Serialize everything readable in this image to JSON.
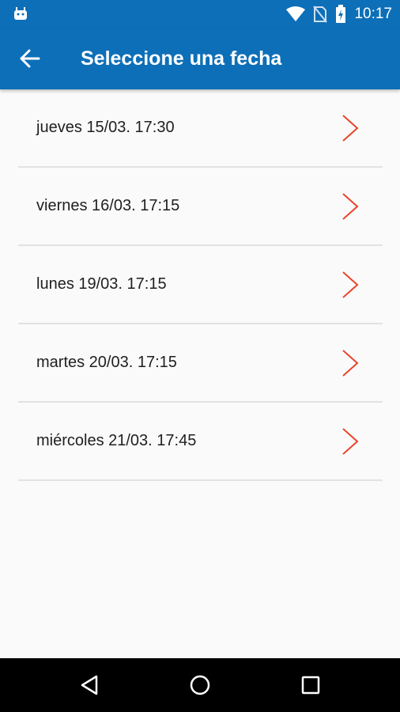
{
  "status_bar": {
    "time": "10:17",
    "icons": [
      "android-icon",
      "wifi-icon",
      "no-sim-icon",
      "battery-charging-icon"
    ]
  },
  "app_bar": {
    "title": "Seleccione una fecha",
    "back_icon": "arrow-back-icon",
    "background": "#0d6fb8"
  },
  "dates": [
    {
      "label": "jueves 15/03. 17:30"
    },
    {
      "label": "viernes 16/03. 17:15"
    },
    {
      "label": "lunes 19/03. 17:15"
    },
    {
      "label": "martes 20/03. 17:15"
    },
    {
      "label": "miércoles 21/03. 17:45"
    }
  ],
  "colors": {
    "chevron": "#e8442c"
  },
  "nav_bar": {
    "buttons": [
      "back-triangle-icon",
      "home-circle-icon",
      "recents-square-icon"
    ]
  }
}
